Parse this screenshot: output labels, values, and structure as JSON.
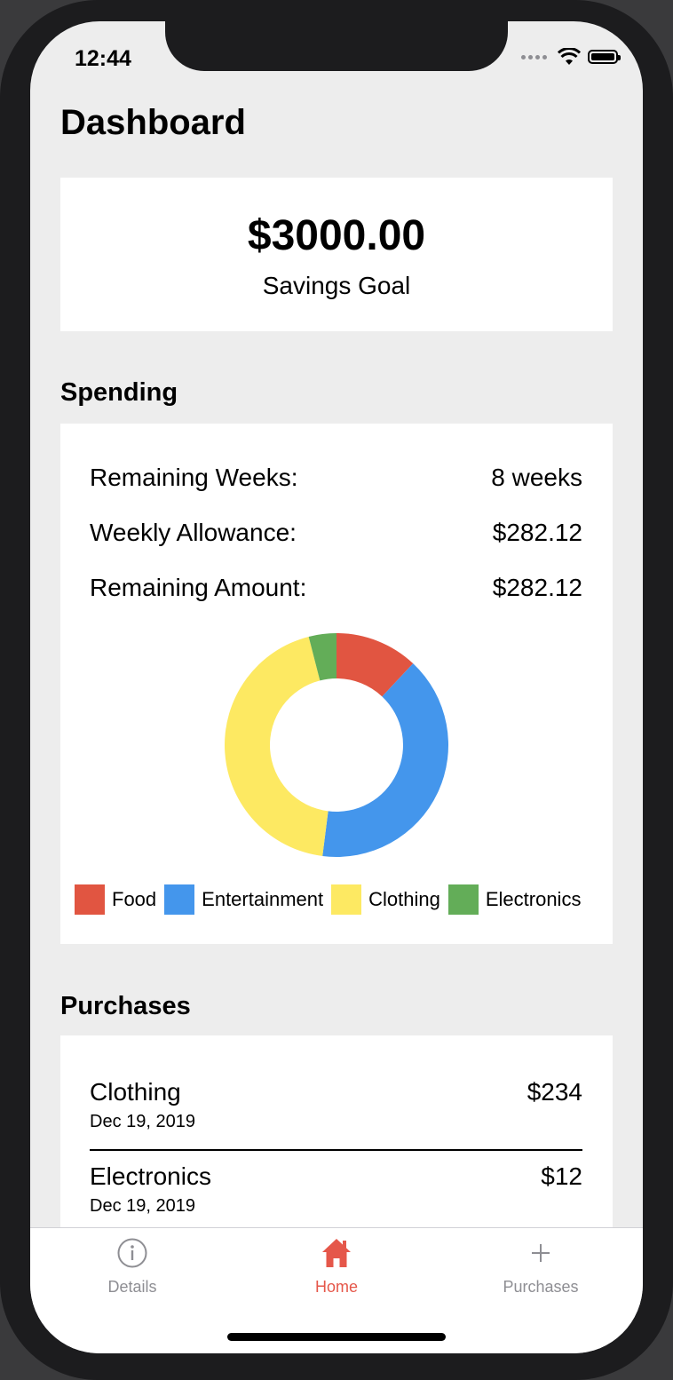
{
  "status_bar": {
    "time": "12:44"
  },
  "header": {
    "title": "Dashboard"
  },
  "savings_goal": {
    "amount": "$3000.00",
    "label": "Savings Goal"
  },
  "spending": {
    "title": "Spending",
    "stats": [
      {
        "label": "Remaining Weeks:",
        "value": "8 weeks"
      },
      {
        "label": "Weekly Allowance:",
        "value": "$282.12"
      },
      {
        "label": "Remaining Amount:",
        "value": "$282.12"
      }
    ]
  },
  "chart_data": {
    "type": "pie",
    "variant": "donut",
    "categories": [
      "Food",
      "Entertainment",
      "Clothing",
      "Electronics"
    ],
    "values": [
      12,
      40,
      44,
      4
    ],
    "colors": [
      "#e15541",
      "#4496ec",
      "#fde962",
      "#63ad58"
    ],
    "legend_position": "bottom"
  },
  "purchases": {
    "title": "Purchases",
    "items": [
      {
        "category": "Clothing",
        "date": "Dec 19, 2019",
        "amount": "$234"
      },
      {
        "category": "Electronics",
        "date": "Dec 19, 2019",
        "amount": "$12"
      }
    ]
  },
  "tab_bar": {
    "accent_color": "#e5574a",
    "tabs": [
      {
        "label": "Details",
        "icon": "info-icon"
      },
      {
        "label": "Home",
        "icon": "home-icon",
        "active": true
      },
      {
        "label": "Purchases",
        "icon": "plus-icon"
      }
    ]
  }
}
